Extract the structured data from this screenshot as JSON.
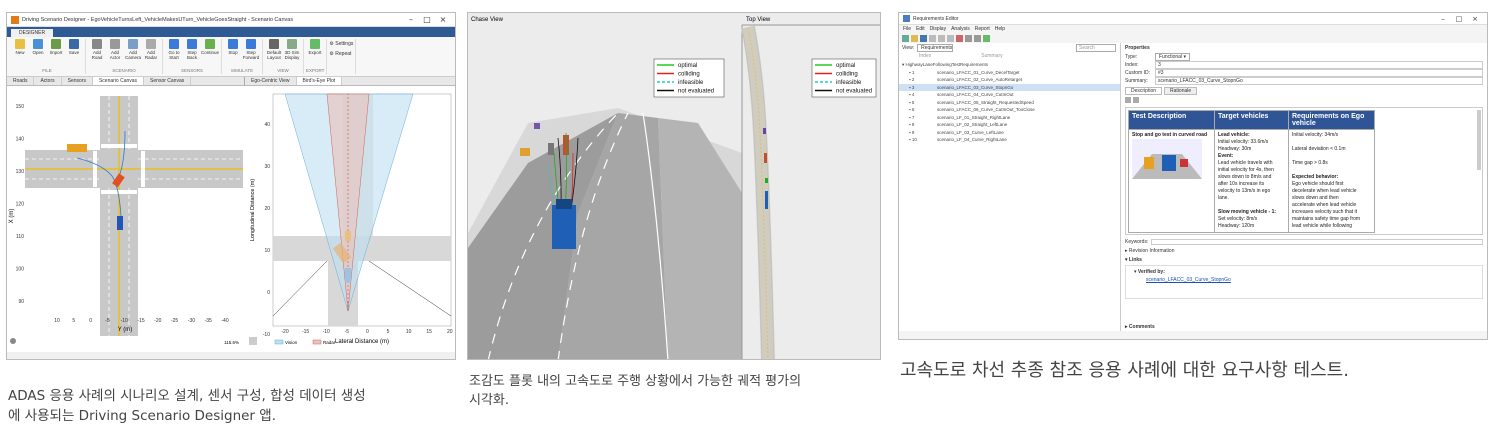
{
  "panel1": {
    "window_title": "Driving Scenario Designer - EgoVehicleTurnsLeft_VehicleMakesUTurn_VehicleGoesStraight - Scenario Canvas",
    "ribbon_tab": "DESIGNER",
    "tool_groups": [
      {
        "label": "FILE",
        "buttons": [
          "New",
          "Open",
          "Import",
          "Save"
        ]
      },
      {
        "label": "SCENARIO",
        "buttons": [
          "Add Road",
          "Add Actor",
          "Add Camera",
          "Add Radar"
        ]
      },
      {
        "label": "SENSORS",
        "buttons": [
          "Go to Start",
          "Step Back",
          "Continue"
        ]
      },
      {
        "label": "SIMULATE",
        "buttons": [
          "Stop",
          "Step Forward"
        ]
      },
      {
        "label": "VIEW",
        "buttons": [
          "Default Layout",
          "3D Sim Display"
        ]
      },
      {
        "label": "EXPORT",
        "buttons": [
          "Export"
        ]
      }
    ],
    "settings_items": [
      "Settings",
      "Repeat"
    ],
    "doc_tabs_left": [
      "Roads",
      "Actors",
      "Sensors",
      "Scenario Canvas",
      "Sensor Canvas"
    ],
    "doc_tabs_right": [
      "Ego-Centric View",
      "Bird's-Eye Plot"
    ],
    "canvas": {
      "y_ticks": [
        "150",
        "140",
        "130",
        "120",
        "110",
        "100",
        "90"
      ],
      "x_ticks": [
        "10",
        "5",
        "0",
        "-5",
        "-10",
        "-15",
        "-20",
        "-25",
        "-30",
        "-35",
        "-40"
      ],
      "xlabel": "Y (m)",
      "ylabel": "X (m)",
      "zoom": "115.6%"
    },
    "bep": {
      "y_ticks": [
        "40",
        "30",
        "20",
        "10",
        "0",
        "-10"
      ],
      "x_ticks": [
        "-20",
        "-15",
        "-10",
        "-5",
        "0",
        "5",
        "10",
        "15",
        "20"
      ],
      "xlabel": "Lateral Distance (m)",
      "ylabel": "Longitudinal Distance (m)",
      "legend": [
        "Vision",
        "Radar"
      ]
    }
  },
  "panel2": {
    "chase_title": "Chase View",
    "top_title": "Top View",
    "legend": [
      {
        "label": "optimal",
        "color": "#22cc22",
        "dash": false
      },
      {
        "label": "colliding",
        "color": "#dd2222",
        "dash": false
      },
      {
        "label": "infeasible",
        "color": "#22cccc",
        "dash": true
      },
      {
        "label": "not evaluated",
        "color": "#111111",
        "dash": false
      }
    ]
  },
  "panel3": {
    "window_title": "Requirements Editor",
    "menu": [
      "File",
      "Edit",
      "Display",
      "Analysis",
      "Report",
      "Help"
    ],
    "view_label": "View:",
    "view_value": "Requirements",
    "search_placeholder": "Search",
    "col_index": "Index",
    "col_summary": "Summary",
    "tree_root": "HighwayLaneFollowingTestRequirements",
    "tree_items": [
      {
        "idx": "1",
        "name": "scenario_LFACC_01_Curve_DecelTarget"
      },
      {
        "idx": "2",
        "name": "scenario_LFACC_02_Curve_AutoRetarget"
      },
      {
        "idx": "3",
        "name": "scenario_LFACC_03_Curve_StopnGo"
      },
      {
        "idx": "4",
        "name": "scenario_LFACC_04_Curve_CutInOut"
      },
      {
        "idx": "5",
        "name": "scenario_LFACC_05_Straight_RequestedSpeed"
      },
      {
        "idx": "6",
        "name": "scenario_LFACC_06_Curve_CutInOut_TooClose"
      },
      {
        "idx": "7",
        "name": "scenario_LF_01_Straight_RightLane"
      },
      {
        "idx": "8",
        "name": "scenario_LF_02_Straight_LeftLane"
      },
      {
        "idx": "9",
        "name": "scenario_LF_03_Curve_LeftLane"
      },
      {
        "idx": "10",
        "name": "scenario_LF_04_Curve_RightLane"
      }
    ],
    "properties_header": "Properties",
    "props": [
      {
        "label": "Type:",
        "value": "Functional"
      },
      {
        "label": "Index:",
        "value": "3"
      },
      {
        "label": "Custom ID:",
        "value": "#3"
      },
      {
        "label": "Summary:",
        "value": "scenario_LFACC_03_Curve_StopnGo"
      }
    ],
    "desc_tabs": [
      "Description",
      "Rationale"
    ],
    "table_headers": [
      "Test Description",
      "Target vehicles",
      "Requirements on Ego vehicle"
    ],
    "col1_text": "Stop and go test in curved road",
    "col2_lines": [
      "Lead vehicle:",
      "Initial velocity: 33.6m/s",
      "Headway: 30m",
      "Event:",
      "Lead vehicle travels with",
      "initial velocity for 4s, then",
      "slows down to 8m/s and",
      "after 10s increase its",
      "velocity to 13m/s in ego",
      "lane.",
      "",
      "Slow moving vehicle - 1:",
      "Set velocity: 8m/s",
      "Headway: 120m"
    ],
    "col3_lines": [
      "Initial velocity: 34m/s",
      "",
      "Lateral deviation < 0.1m",
      "",
      "Time gap > 0.8s",
      "",
      "Expected behavior:",
      "Ego vehicle should first",
      "decelerate when lead vehicle",
      "slows down and then",
      "accelerate when lead vehicle",
      "increases velocity such that it",
      "maintains safety time gap from",
      "lead vehicle while following"
    ],
    "keywords_label": "Keywords:",
    "revision_label": "Revision Information",
    "links_header": "Links",
    "verified_by": "Verified by:",
    "link_text": "scenario_LFACC_03_Curve_StopnGo",
    "comments_header": "Comments"
  },
  "captions": {
    "c1_line1": "ADAS 응용 사례의 시나리오 설계, 센서 구성, 합성 데이터 생성",
    "c1_line2": "에 사용되는 Driving Scenario Designer 앱.",
    "c2_line1": "조감도 플롯 내의 고속도로 주행 상황에서 가능한 궤적 평가의",
    "c2_line2": "시각화.",
    "c3": "고속도로 차선 추종 참조 응용 사례에 대한 요구사항 테스트."
  }
}
